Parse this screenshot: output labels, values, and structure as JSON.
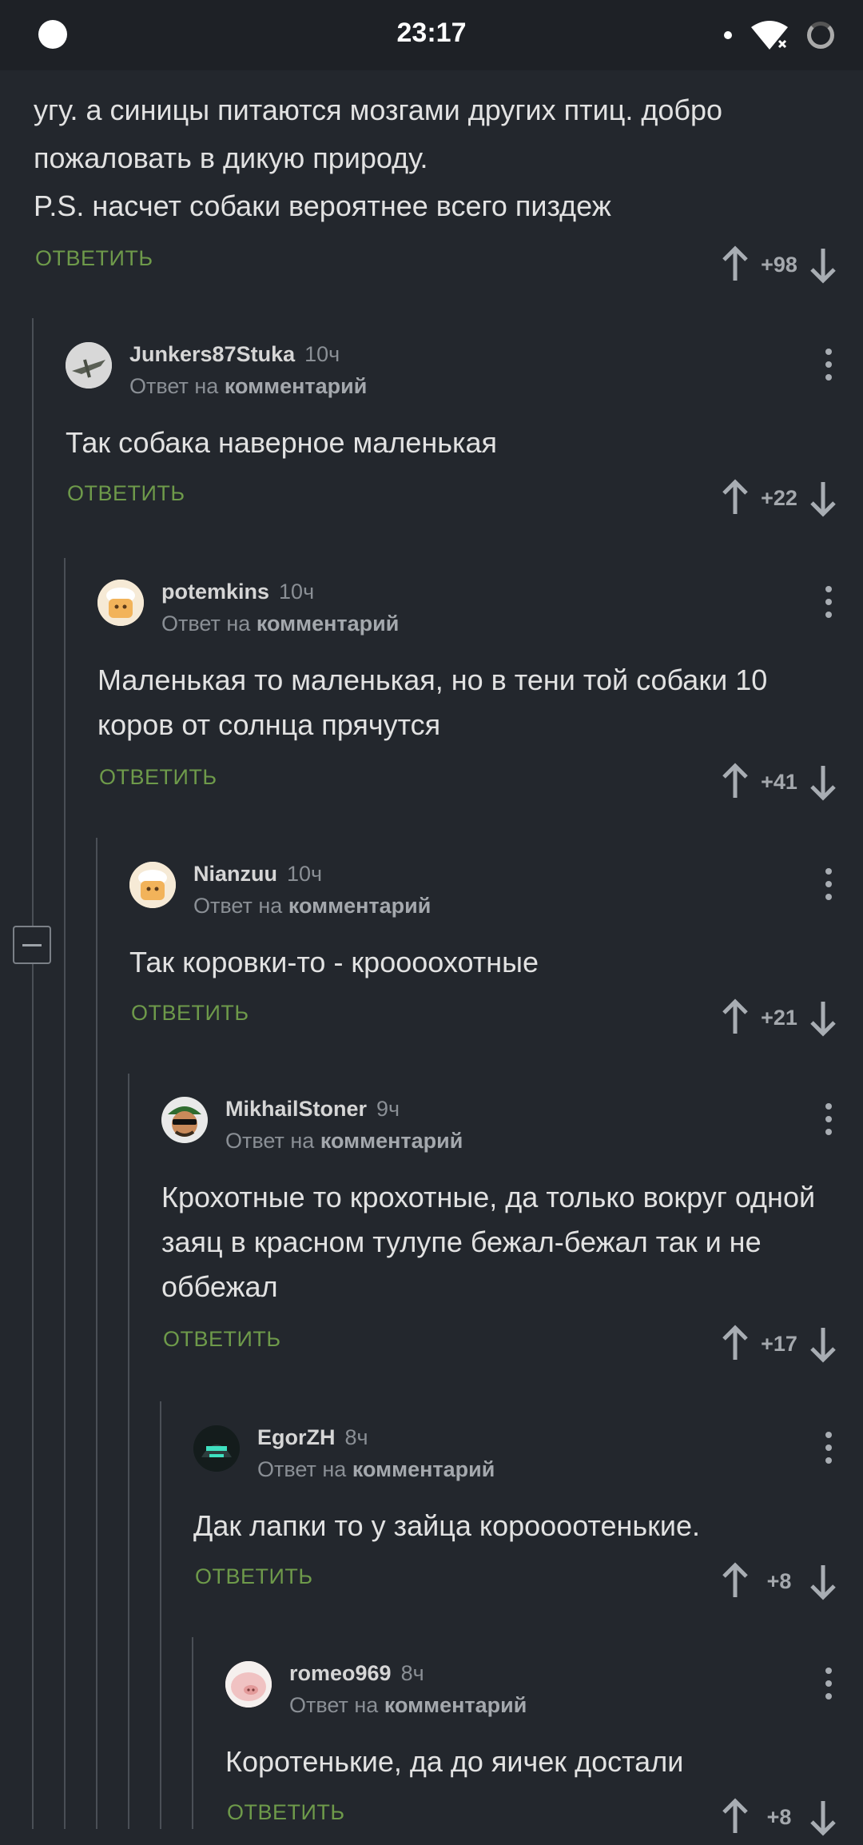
{
  "status_bar": {
    "time": "23:17"
  },
  "reply_to_prefix": "Ответ на",
  "reply_to_link": "комментарий",
  "reply_label": "ОТВЕТИТЬ",
  "top_comment": {
    "text_lines": [
      "угу. а синицы питаются мозгами других птиц. добро",
      "пожаловать в дикую природу.",
      "P.S. насчет собаки вероятнее всего пиздеж"
    ],
    "score": "+98"
  },
  "comments": [
    {
      "user": "Junkers87Stuka",
      "time": "10ч",
      "text": "Так собака наверное маленькая",
      "score": "+22",
      "avatar": "plane-avatar"
    },
    {
      "user": "potemkins",
      "time": "10ч",
      "text": "Маленькая то маленькая, но в тени той собаки 10 коров от солнца прячутся",
      "score": "+41",
      "avatar": "chef-avatar"
    },
    {
      "user": "Nianzuu",
      "time": "10ч",
      "text": "Так коровки-то - кроооохотные",
      "score": "+21",
      "avatar": "chef-avatar"
    },
    {
      "user": "MikhailStoner",
      "time": "9ч",
      "text": "Крохотные то крохотные, да только вокруг одной заяц в красном тулупе бежал-бежал так и не оббежал",
      "score": "+17",
      "avatar": "sunglasses-avatar"
    },
    {
      "user": "EgorZH",
      "time": "8ч",
      "text": "Дак лапки то у зайца короооотенькие.",
      "score": "+8",
      "avatar": "helmet-avatar"
    },
    {
      "user": "romeo969",
      "time": "8ч",
      "text": "Коротенькие, да до яичек достали",
      "score": "+8",
      "avatar": "pig-avatar"
    }
  ],
  "colors": {
    "background": "#23272d",
    "accent_reply": "#6e9a4a",
    "text": "#e2e2e2",
    "muted": "#8a8f95"
  }
}
